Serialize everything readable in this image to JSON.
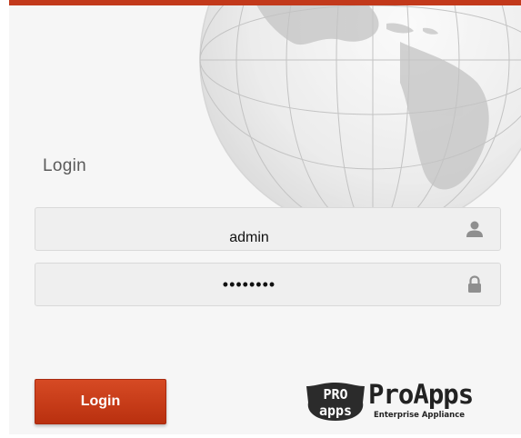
{
  "login_form": {
    "title": "Login",
    "username_value": "admin",
    "password_value": "password",
    "submit_label": "Login"
  },
  "icons": {
    "username": "user-icon",
    "password": "lock-icon"
  },
  "brand": {
    "badge_top": "PRO",
    "badge_bottom": "apps",
    "name": "ProApps",
    "tagline": "Enterprise Appliance"
  },
  "colors": {
    "accent": "#c2391b",
    "button": "#c93a17",
    "panel_background": "#f6f6f6",
    "field_background": "#efefef"
  }
}
